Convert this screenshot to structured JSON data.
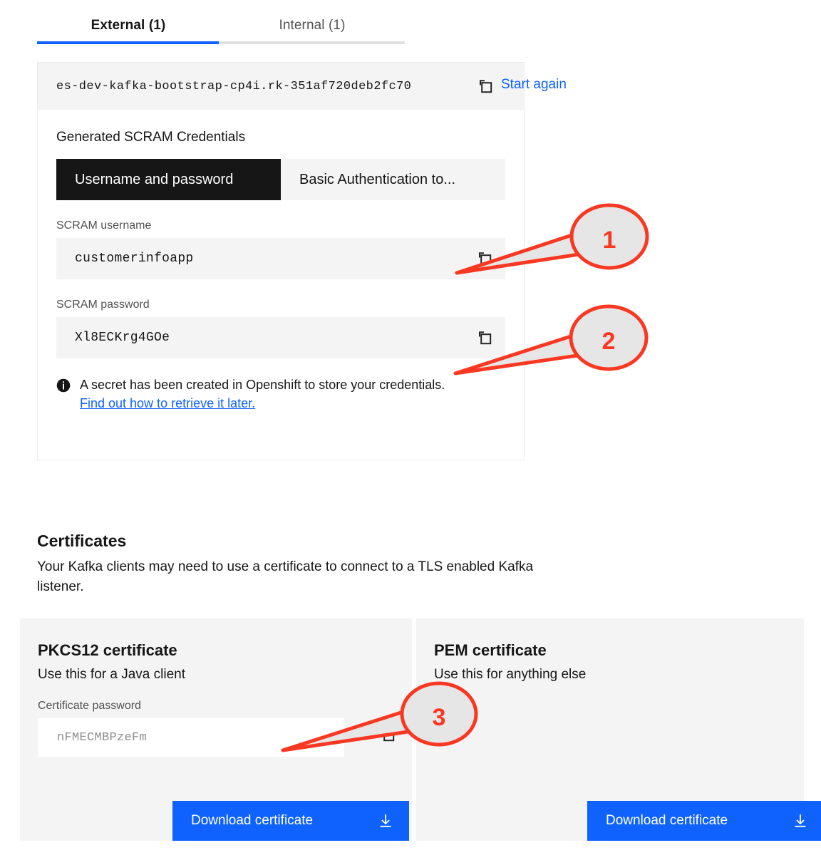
{
  "tabs": [
    {
      "label": "External (1)",
      "active": true
    },
    {
      "label": "Internal (1)",
      "active": false
    }
  ],
  "bootstrap": {
    "value": "es-dev-kafka-bootstrap-cp4i.rk-351af720deb2fc70",
    "copy_icon": "copy-icon",
    "start_again_label": "Start again"
  },
  "credentials": {
    "section_title": "Generated SCRAM Credentials",
    "switcher": [
      {
        "label": "Username and password",
        "selected": true
      },
      {
        "label": "Basic Authentication to...",
        "selected": false
      }
    ],
    "username": {
      "label": "SCRAM username",
      "value": "customerinfoapp",
      "copy_icon": "copy-icon"
    },
    "password": {
      "label": "SCRAM password",
      "value": "Xl8ECKrg4GOe",
      "copy_icon": "copy-icon"
    },
    "notification": {
      "icon": "information-filled-icon",
      "text": "A secret has been created in Openshift to store your credentials.",
      "link_label": "Find out how to retrieve it later."
    }
  },
  "certificates": {
    "title": "Certificates",
    "description": "Your Kafka clients may need to use a certificate to connect to a TLS enabled Kafka listener.",
    "pkcs12": {
      "title": "PKCS12 certificate",
      "subtitle": "Use this for a Java client",
      "password_label": "Certificate password",
      "password_value": "nFMECMBPzeFm",
      "copy_icon": "copy-icon",
      "download_label": "Download certificate",
      "download_icon": "download-icon"
    },
    "pem": {
      "title": "PEM certificate",
      "subtitle": "Use this for anything else",
      "download_label": "Download certificate",
      "download_icon": "download-icon"
    }
  },
  "annotations": [
    {
      "number": "1",
      "target": "username-copy-button"
    },
    {
      "number": "2",
      "target": "password-copy-button"
    },
    {
      "number": "3",
      "target": "certificate-password-copy-button"
    }
  ],
  "colors": {
    "accent_blue": "#0f62fe",
    "annotation_red": "#f93822",
    "annotation_fill": "#e6e6e6",
    "field_gray": "#f4f4f4",
    "selected_dark": "#161616"
  }
}
